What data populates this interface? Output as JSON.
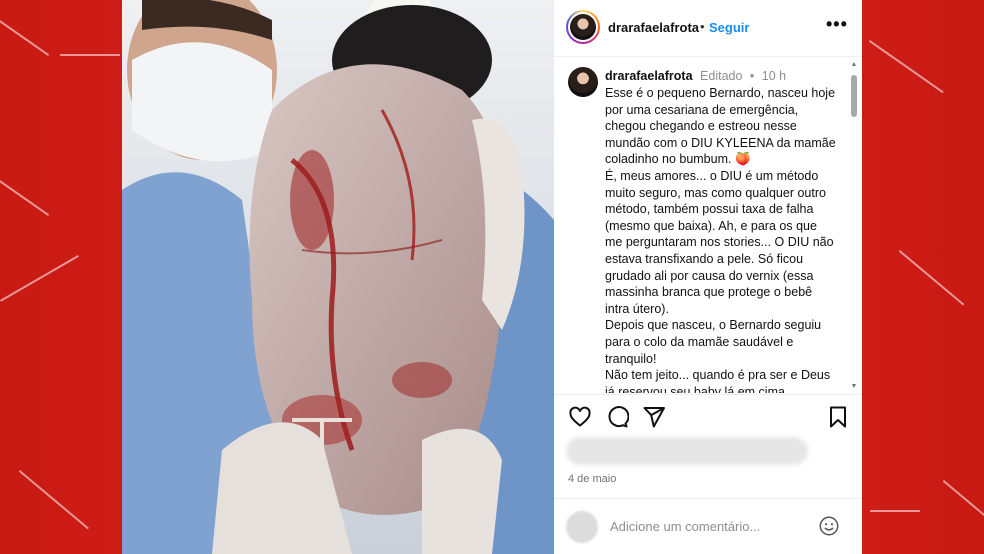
{
  "post": {
    "username": "drarafaelafrota",
    "follow_label": "Seguir",
    "separator": "•",
    "more_label": "•••"
  },
  "caption": {
    "username": "drarafaelafrota",
    "edited_label": "Editado",
    "separator": "•",
    "time": "10 h",
    "text": "Esse é o pequeno Bernardo, nasceu hoje por uma cesariana de emergência, chegou chegando e estreou nesse mundão com o DIU KYLEENA da mamãe coladinho no bumbum. 🍑\nÉ, meus amores... o DIU é um método muito seguro, mas como qualquer outro método, também possui taxa de falha (mesmo que baixa). Ah, e para os que me perguntaram nos stories... O DIU não estava transfixando a pele. Só ficou grudado ali por causa do vernix (essa massinha branca que protege o bebê intra útero).\nDepois que nasceu, o Bernardo seguiu para o colo da mamãe saudável e tranquilo!\nNão tem jeito... quando é pra ser e Deus já reservou seu baby lá em cima"
  },
  "actions": {
    "icons": [
      "heart-icon",
      "comment-icon",
      "share-icon",
      "bookmark-icon"
    ]
  },
  "date": "4 de maio",
  "comment": {
    "placeholder": "Adicione um comentário..."
  },
  "colors": {
    "frame_red": "#d0211b",
    "follow_blue": "#1a8cf0",
    "muted_gray": "#8e8e8e"
  }
}
